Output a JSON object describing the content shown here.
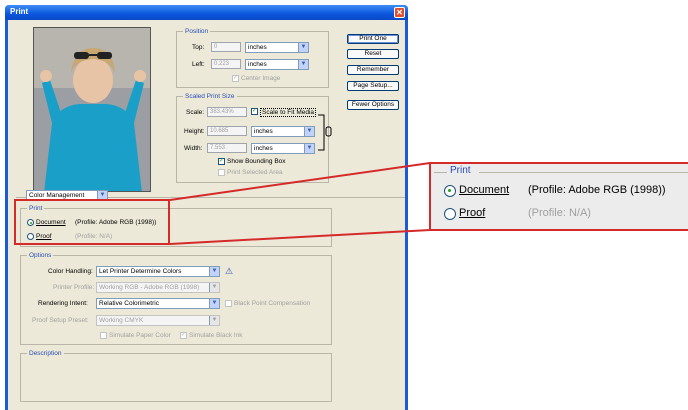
{
  "dialog": {
    "title": "Print",
    "close_glyph": "✕"
  },
  "preview": {
    "alt": "photo of a child in a blue sweater wearing sunglasses on head"
  },
  "position": {
    "legend": "Position",
    "top_label": "Top:",
    "top_value": "0",
    "top_unit": "inches",
    "left_label": "Left:",
    "left_value": "0.223",
    "left_unit": "inches",
    "center_image_label": "Center Image"
  },
  "scaled": {
    "legend": "Scaled Print Size",
    "scale_label": "Scale:",
    "scale_value": "383.43%",
    "fit_label": "Scale to Fit Media",
    "height_label": "Height:",
    "height_value": "10.685",
    "height_unit": "inches",
    "width_label": "Width:",
    "width_value": "7.553",
    "width_unit": "inches",
    "bounding_label": "Show Bounding Box",
    "selected_label": "Print Selected Area"
  },
  "buttons": {
    "print_one": "Print One",
    "reset": "Reset",
    "remember": "Remember",
    "page_setup": "Page Setup...",
    "fewer_options": "Fewer Options"
  },
  "mode_select": "Color Management",
  "print_group": {
    "legend": "Print",
    "document_label": "Document",
    "document_profile": "(Profile: Adobe RGB (1998))",
    "proof_label": "Proof",
    "proof_profile": "(Profile: N/A)"
  },
  "options": {
    "legend": "Options",
    "color_handling_label": "Color Handling:",
    "color_handling_value": "Let Printer Determine Colors",
    "printer_profile_label": "Printer Profile:",
    "printer_profile_value": "Working RGB - Adobe RGB (1998)",
    "rendering_label": "Rendering Intent:",
    "rendering_value": "Relative Colorimetric",
    "bpc_label": "Black Point Compensation",
    "proof_preset_label": "Proof Setup Preset:",
    "proof_preset_value": "Working CMYK",
    "sim_paper_label": "Simulate Paper Color",
    "sim_ink_label": "Simulate Black Ink"
  },
  "description": {
    "legend": "Description"
  },
  "zoom": {
    "legend": "Print",
    "document_label": "Document",
    "document_profile": "(Profile: Adobe RGB (1998))",
    "proof_label": "Proof",
    "proof_profile": "(Profile: N/A)"
  },
  "colors": {
    "callout": "#d42a2a",
    "legend_blue": "#2a4bb5",
    "check_green": "#21a121"
  }
}
